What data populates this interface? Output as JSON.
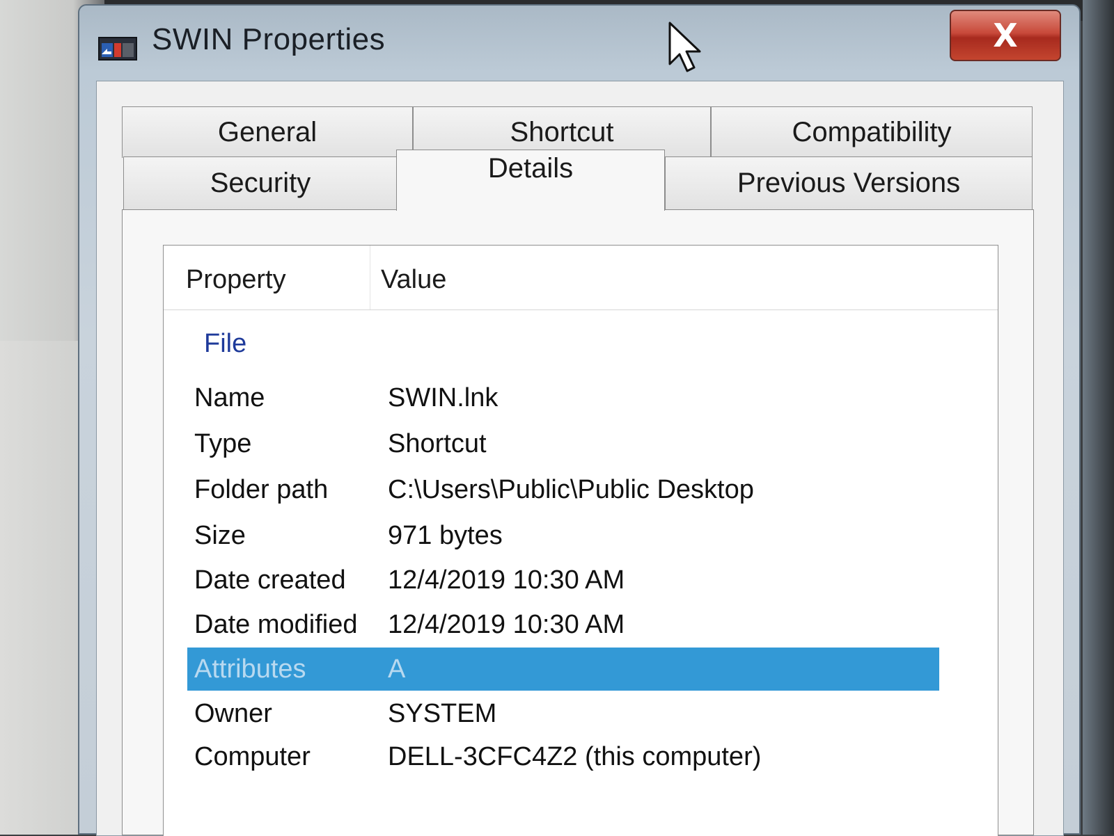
{
  "window": {
    "title": "SWIN Properties",
    "close_label": "X"
  },
  "tabs": {
    "back_row": [
      "General",
      "Shortcut",
      "Compatibility"
    ],
    "front_row": [
      "Security",
      "Details",
      "Previous Versions"
    ],
    "selected": "Details"
  },
  "details": {
    "columns": {
      "property": "Property",
      "value": "Value"
    },
    "group": "File",
    "rows": [
      {
        "property": "Name",
        "value": "SWIN.lnk"
      },
      {
        "property": "Type",
        "value": "Shortcut"
      },
      {
        "property": "Folder path",
        "value": "C:\\Users\\Public\\Public Desktop"
      },
      {
        "property": "Size",
        "value": "971 bytes"
      },
      {
        "property": "Date created",
        "value": "12/4/2019 10:30 AM"
      },
      {
        "property": "Date modified",
        "value": "12/4/2019 10:30 AM"
      },
      {
        "property": "Attributes",
        "value": "A"
      },
      {
        "property": "Owner",
        "value": "SYSTEM"
      },
      {
        "property": "Computer",
        "value": "DELL-3CFC4Z2 (this computer)"
      }
    ],
    "selected_row": "Attributes"
  },
  "colors": {
    "selection": "#3399d6",
    "group_label": "#1e3a9a",
    "close_button": "#c8493a"
  },
  "icons": {
    "app": "shortcut-app-icon",
    "close": "close-icon",
    "cursor": "mouse-cursor-icon"
  }
}
